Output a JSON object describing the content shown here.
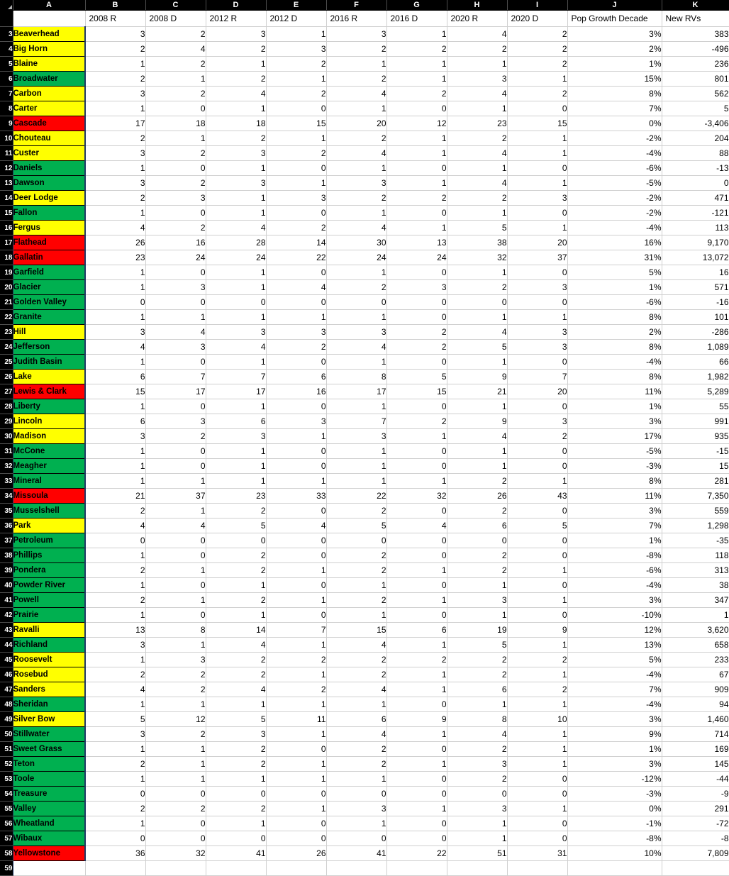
{
  "spreadsheet": {
    "column_letters": [
      "A",
      "B",
      "C",
      "D",
      "E",
      "F",
      "G",
      "H",
      "I",
      "J",
      "K"
    ],
    "field_headers": {
      "a": "",
      "b": "2008 R",
      "c": "2008 D",
      "d": "2012 R",
      "e": "2012 D",
      "f": "2016 R",
      "g": "2016 D",
      "h": "2020 R",
      "i": "2020 D",
      "j": "Pop Growth Decade",
      "k": "New RVs"
    },
    "colors": {
      "yellow": "#FFFF00",
      "green": "#00B050",
      "red": "#FF0000",
      "header_bar": "#000000",
      "gridline": "#D0D0D0",
      "selection_border": "#1F3864"
    },
    "first_data_row_number": 3,
    "rows": [
      {
        "n": "3",
        "name": "Beaverhead",
        "fill": "yellow",
        "v": [
          "3",
          "2",
          "3",
          "1",
          "3",
          "1",
          "4",
          "2",
          "3%",
          "383"
        ]
      },
      {
        "n": "4",
        "name": "Big Horn",
        "fill": "yellow",
        "v": [
          "2",
          "4",
          "2",
          "3",
          "2",
          "2",
          "2",
          "2",
          "2%",
          "-496"
        ]
      },
      {
        "n": "5",
        "name": "Blaine",
        "fill": "yellow",
        "v": [
          "1",
          "2",
          "1",
          "2",
          "1",
          "1",
          "1",
          "2",
          "1%",
          "236"
        ]
      },
      {
        "n": "6",
        "name": "Broadwater",
        "fill": "green",
        "v": [
          "2",
          "1",
          "2",
          "1",
          "2",
          "1",
          "3",
          "1",
          "15%",
          "801"
        ]
      },
      {
        "n": "7",
        "name": "Carbon",
        "fill": "yellow",
        "v": [
          "3",
          "2",
          "4",
          "2",
          "4",
          "2",
          "4",
          "2",
          "8%",
          "562"
        ]
      },
      {
        "n": "8",
        "name": "Carter",
        "fill": "yellow",
        "v": [
          "1",
          "0",
          "1",
          "0",
          "1",
          "0",
          "1",
          "0",
          "7%",
          "5"
        ]
      },
      {
        "n": "9",
        "name": "Cascade",
        "fill": "red",
        "v": [
          "17",
          "18",
          "18",
          "15",
          "20",
          "12",
          "23",
          "15",
          "0%",
          "-3,406"
        ]
      },
      {
        "n": "10",
        "name": "Chouteau",
        "fill": "yellow",
        "v": [
          "2",
          "1",
          "2",
          "1",
          "2",
          "1",
          "2",
          "1",
          "-2%",
          "204"
        ]
      },
      {
        "n": "11",
        "name": "Custer",
        "fill": "yellow",
        "v": [
          "3",
          "2",
          "3",
          "2",
          "4",
          "1",
          "4",
          "1",
          "-4%",
          "88"
        ]
      },
      {
        "n": "12",
        "name": "Daniels",
        "fill": "green",
        "v": [
          "1",
          "0",
          "1",
          "0",
          "1",
          "0",
          "1",
          "0",
          "-6%",
          "-13"
        ]
      },
      {
        "n": "13",
        "name": "Dawson",
        "fill": "green",
        "v": [
          "3",
          "2",
          "3",
          "1",
          "3",
          "1",
          "4",
          "1",
          "-5%",
          "0"
        ]
      },
      {
        "n": "14",
        "name": "Deer Lodge",
        "fill": "yellow",
        "v": [
          "2",
          "3",
          "1",
          "3",
          "2",
          "2",
          "2",
          "3",
          "-2%",
          "471"
        ]
      },
      {
        "n": "15",
        "name": "Fallon",
        "fill": "green",
        "v": [
          "1",
          "0",
          "1",
          "0",
          "1",
          "0",
          "1",
          "0",
          "-2%",
          "-121"
        ]
      },
      {
        "n": "16",
        "name": "Fergus",
        "fill": "yellow",
        "v": [
          "4",
          "2",
          "4",
          "2",
          "4",
          "1",
          "5",
          "1",
          "-4%",
          "113"
        ]
      },
      {
        "n": "17",
        "name": "Flathead",
        "fill": "red",
        "v": [
          "26",
          "16",
          "28",
          "14",
          "30",
          "13",
          "38",
          "20",
          "16%",
          "9,170"
        ]
      },
      {
        "n": "18",
        "name": "Gallatin",
        "fill": "red",
        "v": [
          "23",
          "24",
          "24",
          "22",
          "24",
          "24",
          "32",
          "37",
          "31%",
          "13,072"
        ]
      },
      {
        "n": "19",
        "name": "Garfield",
        "fill": "green",
        "v": [
          "1",
          "0",
          "1",
          "0",
          "1",
          "0",
          "1",
          "0",
          "5%",
          "16"
        ]
      },
      {
        "n": "20",
        "name": "Glacier",
        "fill": "green",
        "v": [
          "1",
          "3",
          "1",
          "4",
          "2",
          "3",
          "2",
          "3",
          "1%",
          "571"
        ]
      },
      {
        "n": "21",
        "name": "Golden Valley",
        "fill": "green",
        "v": [
          "0",
          "0",
          "0",
          "0",
          "0",
          "0",
          "0",
          "0",
          "-6%",
          "-16"
        ]
      },
      {
        "n": "22",
        "name": "Granite",
        "fill": "green",
        "v": [
          "1",
          "1",
          "1",
          "1",
          "1",
          "0",
          "1",
          "1",
          "8%",
          "101"
        ]
      },
      {
        "n": "23",
        "name": "Hill",
        "fill": "yellow",
        "v": [
          "3",
          "4",
          "3",
          "3",
          "3",
          "2",
          "4",
          "3",
          "2%",
          "-286"
        ]
      },
      {
        "n": "24",
        "name": "Jefferson",
        "fill": "green",
        "v": [
          "4",
          "3",
          "4",
          "2",
          "4",
          "2",
          "5",
          "3",
          "8%",
          "1,089"
        ]
      },
      {
        "n": "25",
        "name": "Judith Basin",
        "fill": "green",
        "v": [
          "1",
          "0",
          "1",
          "0",
          "1",
          "0",
          "1",
          "0",
          "-4%",
          "66"
        ]
      },
      {
        "n": "26",
        "name": "Lake",
        "fill": "yellow",
        "v": [
          "6",
          "7",
          "7",
          "6",
          "8",
          "5",
          "9",
          "7",
          "8%",
          "1,982"
        ]
      },
      {
        "n": "27",
        "name": "Lewis & Clark",
        "fill": "red",
        "v": [
          "15",
          "17",
          "17",
          "16",
          "17",
          "15",
          "21",
          "20",
          "11%",
          "5,289"
        ]
      },
      {
        "n": "28",
        "name": "Liberty",
        "fill": "green",
        "v": [
          "1",
          "0",
          "1",
          "0",
          "1",
          "0",
          "1",
          "0",
          "1%",
          "55"
        ]
      },
      {
        "n": "29",
        "name": "Lincoln",
        "fill": "yellow",
        "v": [
          "6",
          "3",
          "6",
          "3",
          "7",
          "2",
          "9",
          "3",
          "3%",
          "991"
        ]
      },
      {
        "n": "30",
        "name": "Madison",
        "fill": "yellow",
        "v": [
          "3",
          "2",
          "3",
          "1",
          "3",
          "1",
          "4",
          "2",
          "17%",
          "935"
        ]
      },
      {
        "n": "31",
        "name": "McCone",
        "fill": "green",
        "v": [
          "1",
          "0",
          "1",
          "0",
          "1",
          "0",
          "1",
          "0",
          "-5%",
          "-15"
        ]
      },
      {
        "n": "32",
        "name": "Meagher",
        "fill": "green",
        "v": [
          "1",
          "0",
          "1",
          "0",
          "1",
          "0",
          "1",
          "0",
          "-3%",
          "15"
        ]
      },
      {
        "n": "33",
        "name": "Mineral",
        "fill": "green",
        "v": [
          "1",
          "1",
          "1",
          "1",
          "1",
          "1",
          "2",
          "1",
          "8%",
          "281"
        ]
      },
      {
        "n": "34",
        "name": "Missoula",
        "fill": "red",
        "v": [
          "21",
          "37",
          "23",
          "33",
          "22",
          "32",
          "26",
          "43",
          "11%",
          "7,350"
        ]
      },
      {
        "n": "35",
        "name": "Musselshell",
        "fill": "green",
        "v": [
          "2",
          "1",
          "2",
          "0",
          "2",
          "0",
          "2",
          "0",
          "3%",
          "559"
        ]
      },
      {
        "n": "36",
        "name": "Park",
        "fill": "yellow",
        "v": [
          "4",
          "4",
          "5",
          "4",
          "5",
          "4",
          "6",
          "5",
          "7%",
          "1,298"
        ]
      },
      {
        "n": "37",
        "name": "Petroleum",
        "fill": "green",
        "v": [
          "0",
          "0",
          "0",
          "0",
          "0",
          "0",
          "0",
          "0",
          "1%",
          "-35"
        ]
      },
      {
        "n": "38",
        "name": "Phillips",
        "fill": "green",
        "v": [
          "1",
          "0",
          "2",
          "0",
          "2",
          "0",
          "2",
          "0",
          "-8%",
          "118"
        ]
      },
      {
        "n": "39",
        "name": "Pondera",
        "fill": "green",
        "v": [
          "2",
          "1",
          "2",
          "1",
          "2",
          "1",
          "2",
          "1",
          "-6%",
          "313"
        ]
      },
      {
        "n": "40",
        "name": "Powder River",
        "fill": "green",
        "v": [
          "1",
          "0",
          "1",
          "0",
          "1",
          "0",
          "1",
          "0",
          "-4%",
          "38"
        ]
      },
      {
        "n": "41",
        "name": "Powell",
        "fill": "green",
        "v": [
          "2",
          "1",
          "2",
          "1",
          "2",
          "1",
          "3",
          "1",
          "3%",
          "347"
        ]
      },
      {
        "n": "42",
        "name": "Prairie",
        "fill": "green",
        "v": [
          "1",
          "0",
          "1",
          "0",
          "1",
          "0",
          "1",
          "0",
          "-10%",
          "1"
        ]
      },
      {
        "n": "43",
        "name": "Ravalli",
        "fill": "yellow",
        "v": [
          "13",
          "8",
          "14",
          "7",
          "15",
          "6",
          "19",
          "9",
          "12%",
          "3,620"
        ]
      },
      {
        "n": "44",
        "name": "Richland",
        "fill": "green",
        "v": [
          "3",
          "1",
          "4",
          "1",
          "4",
          "1",
          "5",
          "1",
          "13%",
          "658"
        ]
      },
      {
        "n": "45",
        "name": "Roosevelt",
        "fill": "yellow",
        "v": [
          "1",
          "3",
          "2",
          "2",
          "2",
          "2",
          "2",
          "2",
          "5%",
          "233"
        ]
      },
      {
        "n": "46",
        "name": "Rosebud",
        "fill": "yellow",
        "v": [
          "2",
          "2",
          "2",
          "1",
          "2",
          "1",
          "2",
          "1",
          "-4%",
          "67"
        ]
      },
      {
        "n": "47",
        "name": "Sanders",
        "fill": "yellow",
        "v": [
          "4",
          "2",
          "4",
          "2",
          "4",
          "1",
          "6",
          "2",
          "7%",
          "909"
        ]
      },
      {
        "n": "48",
        "name": "Sheridan",
        "fill": "green",
        "v": [
          "1",
          "1",
          "1",
          "1",
          "1",
          "0",
          "1",
          "1",
          "-4%",
          "94"
        ]
      },
      {
        "n": "49",
        "name": "Silver Bow",
        "fill": "yellow",
        "v": [
          "5",
          "12",
          "5",
          "11",
          "6",
          "9",
          "8",
          "10",
          "3%",
          "1,460"
        ]
      },
      {
        "n": "50",
        "name": "Stillwater",
        "fill": "green",
        "v": [
          "3",
          "2",
          "3",
          "1",
          "4",
          "1",
          "4",
          "1",
          "9%",
          "714"
        ]
      },
      {
        "n": "51",
        "name": "Sweet Grass",
        "fill": "green",
        "v": [
          "1",
          "1",
          "2",
          "0",
          "2",
          "0",
          "2",
          "1",
          "1%",
          "169"
        ]
      },
      {
        "n": "52",
        "name": "Teton",
        "fill": "green",
        "v": [
          "2",
          "1",
          "2",
          "1",
          "2",
          "1",
          "3",
          "1",
          "3%",
          "145"
        ]
      },
      {
        "n": "53",
        "name": "Toole",
        "fill": "green",
        "v": [
          "1",
          "1",
          "1",
          "1",
          "1",
          "0",
          "2",
          "0",
          "-12%",
          "-44"
        ]
      },
      {
        "n": "54",
        "name": "Treasure",
        "fill": "green",
        "v": [
          "0",
          "0",
          "0",
          "0",
          "0",
          "0",
          "0",
          "0",
          "-3%",
          "-9"
        ]
      },
      {
        "n": "55",
        "name": "Valley",
        "fill": "green",
        "v": [
          "2",
          "2",
          "2",
          "1",
          "3",
          "1",
          "3",
          "1",
          "0%",
          "291"
        ]
      },
      {
        "n": "56",
        "name": "Wheatland",
        "fill": "green",
        "v": [
          "1",
          "0",
          "1",
          "0",
          "1",
          "0",
          "1",
          "0",
          "-1%",
          "-72"
        ]
      },
      {
        "n": "57",
        "name": "Wibaux",
        "fill": "green",
        "v": [
          "0",
          "0",
          "0",
          "0",
          "0",
          "0",
          "1",
          "0",
          "-8%",
          "-8"
        ]
      },
      {
        "n": "58",
        "name": "Yellowstone",
        "fill": "red",
        "v": [
          "36",
          "32",
          "41",
          "26",
          "41",
          "22",
          "51",
          "31",
          "10%",
          "7,809"
        ]
      }
    ]
  }
}
